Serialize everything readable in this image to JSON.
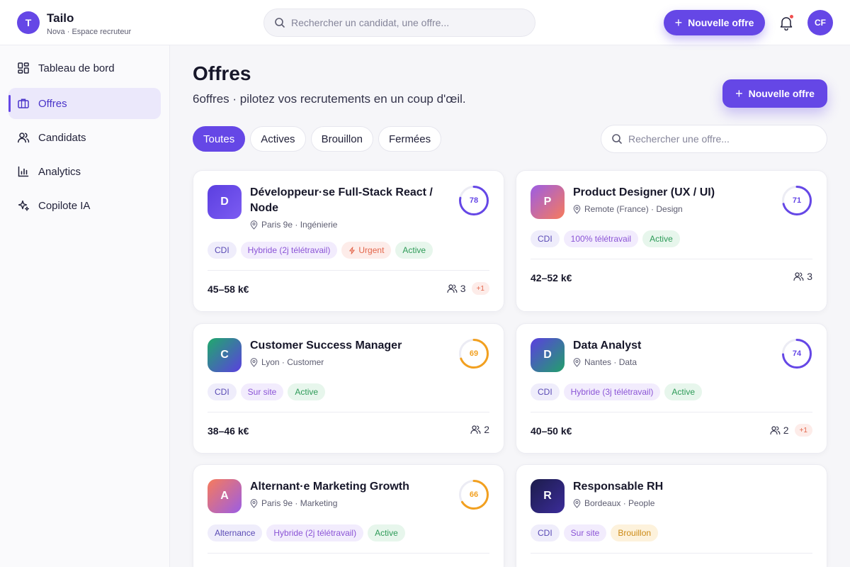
{
  "brand": {
    "initial": "T",
    "name": "Tailo",
    "subtitle": "Nova · Espace recruteur"
  },
  "topbar": {
    "search_placeholder": "Rechercher un candidat, une offre...",
    "new_offer_label": "Nouvelle offre",
    "user_initials": "CF"
  },
  "sidebar": {
    "items": [
      {
        "label": "Tableau de bord",
        "icon": "dashboard-icon",
        "active": false
      },
      {
        "label": "Offres",
        "icon": "briefcase-icon",
        "active": true
      },
      {
        "label": "Candidats",
        "icon": "users-icon",
        "active": false
      },
      {
        "label": "Analytics",
        "icon": "bar-chart-icon",
        "active": false
      },
      {
        "label": "Copilote IA",
        "icon": "sparkles-icon",
        "active": false
      }
    ]
  },
  "main": {
    "title": "Offres",
    "subtitle": "6offres · pilotez vos recrutements en un coup d'œil.",
    "new_offer_label": "Nouvelle offre",
    "filters": [
      "Toutes",
      "Actives",
      "Brouillon",
      "Fermées"
    ],
    "active_filter": "Toutes",
    "search_placeholder": "Rechercher une offre..."
  },
  "colors": {
    "accent": "#6547e6",
    "score_purple": "#6547e6",
    "score_orange": "#f2a01f",
    "status_active": "#2e9b58",
    "status_draft": "#cc8a15",
    "urgent": "#e3664b"
  },
  "offers": [
    {
      "initial": "D",
      "title": "Développeur·se Full-Stack React / Node",
      "location": "Paris 9e",
      "department": "Ingénierie",
      "score": "78",
      "score_color": "#6547e6",
      "avatar_colors": [
        "#5b3fe0",
        "#7c5cf2"
      ],
      "tags": [
        "CDI",
        "Hybride (2j télétravail)",
        "Urgent",
        "Active"
      ],
      "salary": "45–58 k€",
      "candidates": "3",
      "new_candidates": "+1"
    },
    {
      "initial": "P",
      "title": "Product Designer (UX / UI)",
      "location": "Remote (France)",
      "department": "Design",
      "score": "71",
      "score_color": "#6547e6",
      "avatar_colors": [
        "#9b5de5",
        "#f77b5b"
      ],
      "tags": [
        "CDI",
        "100% télétravail",
        "Active"
      ],
      "salary": "42–52 k€",
      "candidates": "3",
      "new_candidates": ""
    },
    {
      "initial": "C",
      "title": "Customer Success Manager",
      "location": "Lyon",
      "department": "Customer",
      "score": "69",
      "score_color": "#f2a01f",
      "avatar_colors": [
        "#1faa6b",
        "#5b3fe0"
      ],
      "tags": [
        "CDI",
        "Sur site",
        "Active"
      ],
      "salary": "38–46 k€",
      "candidates": "2",
      "new_candidates": ""
    },
    {
      "initial": "D",
      "title": "Data Analyst",
      "location": "Nantes",
      "department": "Data",
      "score": "74",
      "score_color": "#6547e6",
      "avatar_colors": [
        "#5b3fe0",
        "#22a06b"
      ],
      "tags": [
        "CDI",
        "Hybride (3j télétravail)",
        "Active"
      ],
      "salary": "40–50 k€",
      "candidates": "2",
      "new_candidates": "+1"
    },
    {
      "initial": "A",
      "title": "Alternant·e Marketing Growth",
      "location": "Paris 9e",
      "department": "Marketing",
      "score": "66",
      "score_color": "#f2a01f",
      "avatar_colors": [
        "#f77b5b",
        "#9b5de5"
      ],
      "tags": [
        "Alternance",
        "Hybride (2j télétravail)",
        "Active"
      ],
      "salary": "",
      "candidates": "",
      "new_candidates": ""
    },
    {
      "initial": "R",
      "title": "Responsable RH",
      "location": "Bordeaux",
      "department": "People",
      "score": "",
      "score_color": "",
      "avatar_colors": [
        "#1c1c4a",
        "#3b2c9a"
      ],
      "tags": [
        "CDI",
        "Sur site",
        "Brouillon"
      ],
      "salary": "",
      "candidates": "",
      "new_candidates": ""
    }
  ]
}
